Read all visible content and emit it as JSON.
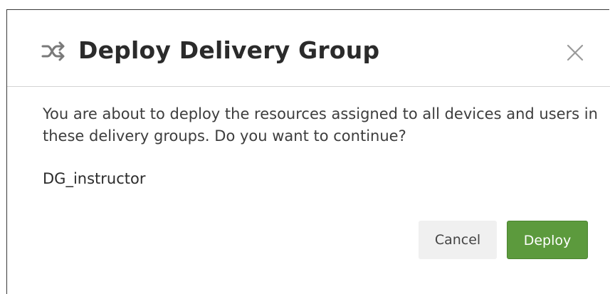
{
  "dialog": {
    "title": "Deploy Delivery Group",
    "title_icon": "shuffle-icon",
    "close_icon": "close-icon",
    "message": "You are about to deploy the resources assigned to all devices and users in these delivery groups. Do you want to continue?",
    "group_name": "DG_instructor"
  },
  "buttons": {
    "cancel_label": "Cancel",
    "deploy_label": "Deploy"
  },
  "colors": {
    "primary_button": "#5c9a3d",
    "secondary_button": "#f0f0f0",
    "icon": "#7a7a7a"
  }
}
